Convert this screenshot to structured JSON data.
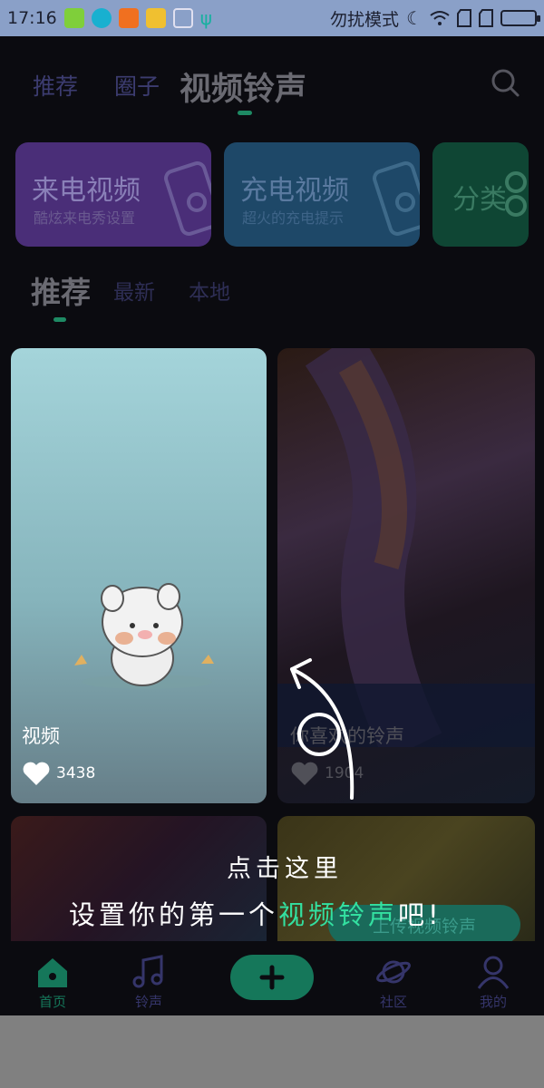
{
  "status_bar": {
    "time": "17:16",
    "mode_text": "勿扰模式",
    "icons": [
      "android-icon",
      "app-icon",
      "warning-icon",
      "folder-icon",
      "broom-icon",
      "usb-icon",
      "moon-icon",
      "wifi-icon",
      "sim-icon",
      "sim-icon",
      "battery-icon"
    ]
  },
  "top_nav": {
    "tabs": [
      "推荐",
      "圈子",
      "视频铃声"
    ],
    "active_tab": "视频铃声"
  },
  "categories": [
    {
      "title": "来电视频",
      "subtitle": "酷炫来电秀设置",
      "color": "#4a2e78",
      "icon": "phone-film-icon"
    },
    {
      "title": "充电视频",
      "subtitle": "超火的充电提示",
      "color": "#1e4868",
      "icon": "phone-film-icon"
    },
    {
      "title": "分类",
      "subtitle": "",
      "color": "#0f4634",
      "icon": "category-icon"
    }
  ],
  "sub_tabs": [
    "推荐",
    "最新",
    "本地"
  ],
  "videos": [
    {
      "title": "视频",
      "likes": "3438"
    },
    {
      "title": "你喜欢的铃声",
      "likes": "1904"
    }
  ],
  "upload_button": "上传视频铃声",
  "tutorial_overlay": {
    "line1": "点击这里",
    "line2_prefix": "设置你的第一个",
    "line2_highlight": "视频铃声",
    "line2_suffix": "吧!"
  },
  "bottom_nav": [
    "首页",
    "铃声",
    "",
    "社区",
    "我的"
  ],
  "colors": {
    "accent": "#1e8a64",
    "highlight": "#33e0a0",
    "background": "#0b0b10"
  }
}
